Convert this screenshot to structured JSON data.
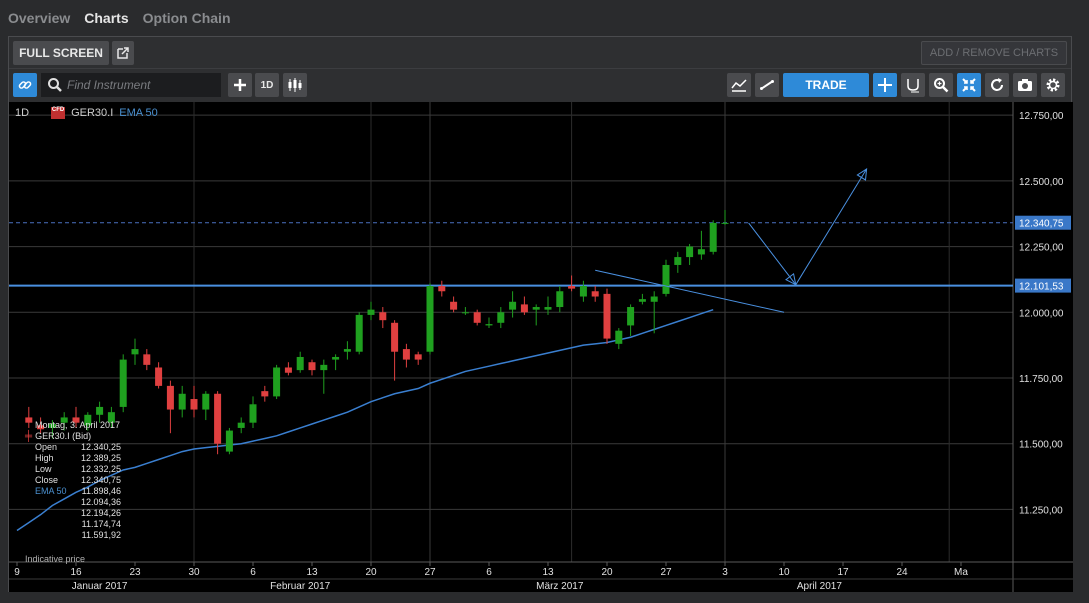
{
  "tabs": [
    {
      "label": "Overview",
      "active": false
    },
    {
      "label": "Charts",
      "active": true
    },
    {
      "label": "Option Chain",
      "active": false
    }
  ],
  "topbar": {
    "fullscreen_label": "FULL SCREEN",
    "add_remove_label": "ADD / REMOVE CHARTS"
  },
  "toolbar": {
    "search_placeholder": "Find Instrument",
    "period_label": "1D",
    "trade_label": "TRADE"
  },
  "legend": {
    "interval": "1D",
    "instrument": "GER30.I",
    "indicator": "EMA 50",
    "cfd_label": "CFD"
  },
  "infobox": {
    "date": "Montag, 3. April 2017",
    "instrument": "GER30.I (Bid)",
    "rows": [
      {
        "k": "Open",
        "v": "12.340,25"
      },
      {
        "k": "High",
        "v": "12.389,25"
      },
      {
        "k": "Low",
        "v": "12.332,25"
      },
      {
        "k": "Close",
        "v": "12.340,75"
      },
      {
        "k": "EMA 50",
        "v": "11.898,46"
      },
      {
        "k": "",
        "v": "12.094,36"
      },
      {
        "k": "",
        "v": "12.194,26"
      },
      {
        "k": "",
        "v": "11.174,74"
      },
      {
        "k": "",
        "v": "11.591,92"
      }
    ],
    "indicative": "Indicative price"
  },
  "colors": {
    "up": "#1fa01f",
    "down": "#e04040",
    "ema": "#3a7fd0",
    "accent": "#2e8ad8"
  },
  "chart_data": {
    "type": "candlestick",
    "instrument": "GER30.I",
    "interval": "1D",
    "ylim": [
      11050,
      12800
    ],
    "y_ticks": [
      12750,
      12500,
      12250,
      12000,
      11750,
      11500,
      11250
    ],
    "y_tick_labels": [
      "12.750,00",
      "12.500,00",
      "12.250,00",
      "12.000,00",
      "11.750,00",
      "11.500,00",
      "11.250,00"
    ],
    "current_price": {
      "value": 12340.75,
      "label": "12.340,75"
    },
    "horizontal_line": {
      "value": 12101.53,
      "label": "12.101,53"
    },
    "x_tick_labels": [
      "9",
      "16",
      "23",
      "30",
      "6",
      "13",
      "20",
      "27",
      "6",
      "13",
      "20",
      "27",
      "3",
      "10",
      "17",
      "24",
      "Ma"
    ],
    "x_tick_cols": [
      0,
      5,
      10,
      15,
      20,
      25,
      30,
      35,
      40,
      45,
      50,
      55,
      60,
      65,
      70,
      75,
      80
    ],
    "month_labels": [
      {
        "label": "Januar 2017",
        "col": 7
      },
      {
        "label": "Februar 2017",
        "col": 24
      },
      {
        "label": "März 2017",
        "col": 46
      },
      {
        "label": "April 2017",
        "col": 68
      }
    ],
    "candles": [
      {
        "o": 11600,
        "h": 11640,
        "l": 11560,
        "c": 11580
      },
      {
        "o": 11570,
        "h": 11600,
        "l": 11540,
        "c": 11555
      },
      {
        "o": 11560,
        "h": 11590,
        "l": 11520,
        "c": 11575
      },
      {
        "o": 11580,
        "h": 11620,
        "l": 11550,
        "c": 11600
      },
      {
        "o": 11600,
        "h": 11640,
        "l": 11560,
        "c": 11580
      },
      {
        "o": 11570,
        "h": 11620,
        "l": 11550,
        "c": 11610
      },
      {
        "o": 11610,
        "h": 11660,
        "l": 11580,
        "c": 11640
      },
      {
        "o": 11580,
        "h": 11640,
        "l": 11560,
        "c": 11620
      },
      {
        "o": 11640,
        "h": 11840,
        "l": 11620,
        "c": 11820
      },
      {
        "o": 11840,
        "h": 11900,
        "l": 11800,
        "c": 11860
      },
      {
        "o": 11840,
        "h": 11860,
        "l": 11780,
        "c": 11800
      },
      {
        "o": 11790,
        "h": 11810,
        "l": 11710,
        "c": 11720
      },
      {
        "o": 11720,
        "h": 11740,
        "l": 11540,
        "c": 11630
      },
      {
        "o": 11630,
        "h": 11720,
        "l": 11600,
        "c": 11690
      },
      {
        "o": 11670,
        "h": 11720,
        "l": 11600,
        "c": 11630
      },
      {
        "o": 11630,
        "h": 11700,
        "l": 11590,
        "c": 11690
      },
      {
        "o": 11690,
        "h": 11700,
        "l": 11460,
        "c": 11500
      },
      {
        "o": 11470,
        "h": 11560,
        "l": 11460,
        "c": 11550
      },
      {
        "o": 11560,
        "h": 11600,
        "l": 11540,
        "c": 11580
      },
      {
        "o": 11580,
        "h": 11680,
        "l": 11560,
        "c": 11650
      },
      {
        "o": 11700,
        "h": 11720,
        "l": 11660,
        "c": 11680
      },
      {
        "o": 11680,
        "h": 11800,
        "l": 11670,
        "c": 11790
      },
      {
        "o": 11790,
        "h": 11810,
        "l": 11760,
        "c": 11770
      },
      {
        "o": 11780,
        "h": 11850,
        "l": 11770,
        "c": 11830
      },
      {
        "o": 11810,
        "h": 11820,
        "l": 11760,
        "c": 11780
      },
      {
        "o": 11780,
        "h": 11820,
        "l": 11690,
        "c": 11800
      },
      {
        "o": 11820,
        "h": 11840,
        "l": 11780,
        "c": 11830
      },
      {
        "o": 11850,
        "h": 11890,
        "l": 11820,
        "c": 11860
      },
      {
        "o": 11850,
        "h": 12000,
        "l": 11840,
        "c": 11990
      },
      {
        "o": 11990,
        "h": 12040,
        "l": 11970,
        "c": 12010
      },
      {
        "o": 12000,
        "h": 12020,
        "l": 11940,
        "c": 11970
      },
      {
        "o": 11960,
        "h": 11970,
        "l": 11740,
        "c": 11850
      },
      {
        "o": 11860,
        "h": 11880,
        "l": 11790,
        "c": 11820
      },
      {
        "o": 11840,
        "h": 11850,
        "l": 11800,
        "c": 11820
      },
      {
        "o": 11850,
        "h": 12110,
        "l": 11840,
        "c": 12100
      },
      {
        "o": 12100,
        "h": 12120,
        "l": 12060,
        "c": 12080
      },
      {
        "o": 12040,
        "h": 12060,
        "l": 12000,
        "c": 12010
      },
      {
        "o": 12000,
        "h": 12020,
        "l": 11990,
        "c": 12000
      },
      {
        "o": 12000,
        "h": 12010,
        "l": 11950,
        "c": 11960
      },
      {
        "o": 11950,
        "h": 11980,
        "l": 11940,
        "c": 11955
      },
      {
        "o": 11960,
        "h": 12020,
        "l": 11940,
        "c": 12000
      },
      {
        "o": 12010,
        "h": 12080,
        "l": 11980,
        "c": 12040
      },
      {
        "o": 12030,
        "h": 12060,
        "l": 11990,
        "c": 12000
      },
      {
        "o": 12010,
        "h": 12030,
        "l": 11950,
        "c": 12020
      },
      {
        "o": 12010,
        "h": 12060,
        "l": 11990,
        "c": 12020
      },
      {
        "o": 12020,
        "h": 12100,
        "l": 12000,
        "c": 12080
      },
      {
        "o": 12100,
        "h": 12140,
        "l": 12080,
        "c": 12090
      },
      {
        "o": 12060,
        "h": 12120,
        "l": 12040,
        "c": 12100
      },
      {
        "o": 12080,
        "h": 12100,
        "l": 12040,
        "c": 12060
      },
      {
        "o": 12070,
        "h": 12090,
        "l": 11880,
        "c": 11900
      },
      {
        "o": 11880,
        "h": 11940,
        "l": 11860,
        "c": 11930
      },
      {
        "o": 11950,
        "h": 12030,
        "l": 11910,
        "c": 12020
      },
      {
        "o": 12040,
        "h": 12070,
        "l": 12030,
        "c": 12050
      },
      {
        "o": 12040,
        "h": 12080,
        "l": 11920,
        "c": 12060
      },
      {
        "o": 12070,
        "h": 12200,
        "l": 12060,
        "c": 12180
      },
      {
        "o": 12180,
        "h": 12230,
        "l": 12150,
        "c": 12210
      },
      {
        "o": 12210,
        "h": 12260,
        "l": 12180,
        "c": 12250
      },
      {
        "o": 12220,
        "h": 12310,
        "l": 12200,
        "c": 12240
      },
      {
        "o": 12230,
        "h": 12350,
        "l": 12220,
        "c": 12340
      },
      {
        "o": 12340,
        "h": 12389,
        "l": 12332,
        "c": 12340
      }
    ],
    "ema": [
      11170,
      11200,
      11230,
      11265,
      11290,
      11315,
      11335,
      11360,
      11380,
      11400,
      11410,
      11425,
      11440,
      11455,
      11470,
      11480,
      11485,
      11490,
      11495,
      11500,
      11510,
      11520,
      11530,
      11545,
      11560,
      11575,
      11590,
      11605,
      11620,
      11640,
      11660,
      11675,
      11690,
      11700,
      11710,
      11730,
      11745,
      11760,
      11775,
      11785,
      11795,
      11805,
      11815,
      11825,
      11835,
      11845,
      11855,
      11865,
      11875,
      11880,
      11885,
      11895,
      11905,
      11920,
      11935,
      11950,
      11965,
      11980,
      11995,
      12010
    ],
    "trendline": {
      "from": {
        "col": 49,
        "v": 12160
      },
      "to": {
        "col": 65,
        "v": 12000
      }
    },
    "projection": [
      {
        "col": 62,
        "v": 12340
      },
      {
        "col": 66,
        "v": 12105
      },
      {
        "col": 72,
        "v": 12545
      }
    ],
    "grid": true
  }
}
